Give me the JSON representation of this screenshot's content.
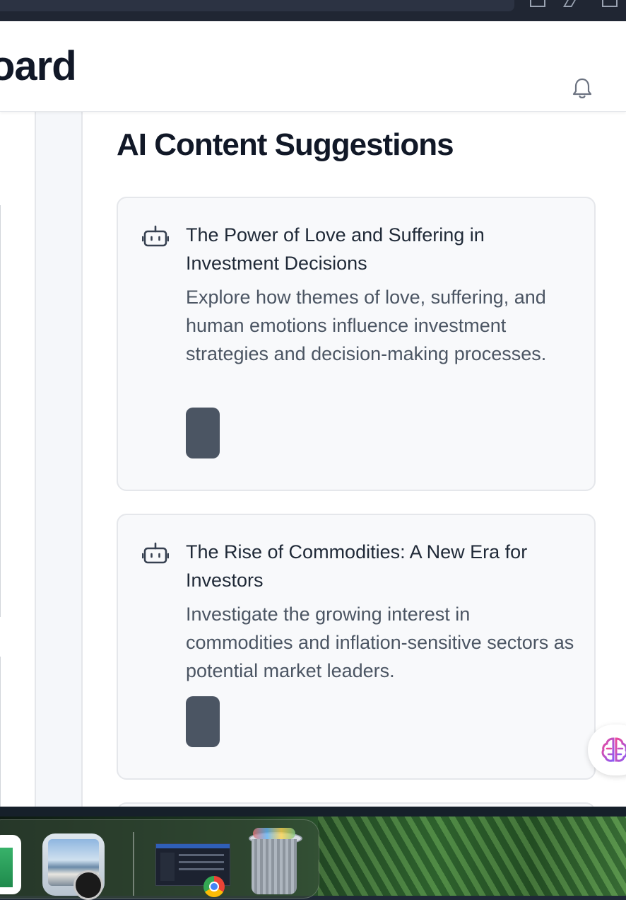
{
  "header": {
    "title_fragment": "oard",
    "bell_icon": "bell-icon"
  },
  "main": {
    "section_title": "AI Content Suggestions",
    "cards": [
      {
        "icon": "robot-icon",
        "title": "The Power of Love and Suffering in Investment Decisions",
        "description": "Explore how themes of love, suffering, and human emotions influence investment strategies and decision-making processes."
      },
      {
        "icon": "robot-icon",
        "title": "The Rise of Commodities: A New Era for Investors",
        "description": "Investigate the growing interest in commodities and inflation-sensitive sectors as potential market leaders."
      }
    ]
  },
  "floating": {
    "icon": "brain-icon"
  },
  "dock": {
    "items": [
      "numbers-app-icon",
      "preview-app-icon",
      "chrome-window-icon",
      "trash-icon"
    ]
  },
  "colors": {
    "title_text": "#111827",
    "card_bg": "#f8f9fb",
    "card_border": "#e5e7eb",
    "button": "#4b5563"
  }
}
